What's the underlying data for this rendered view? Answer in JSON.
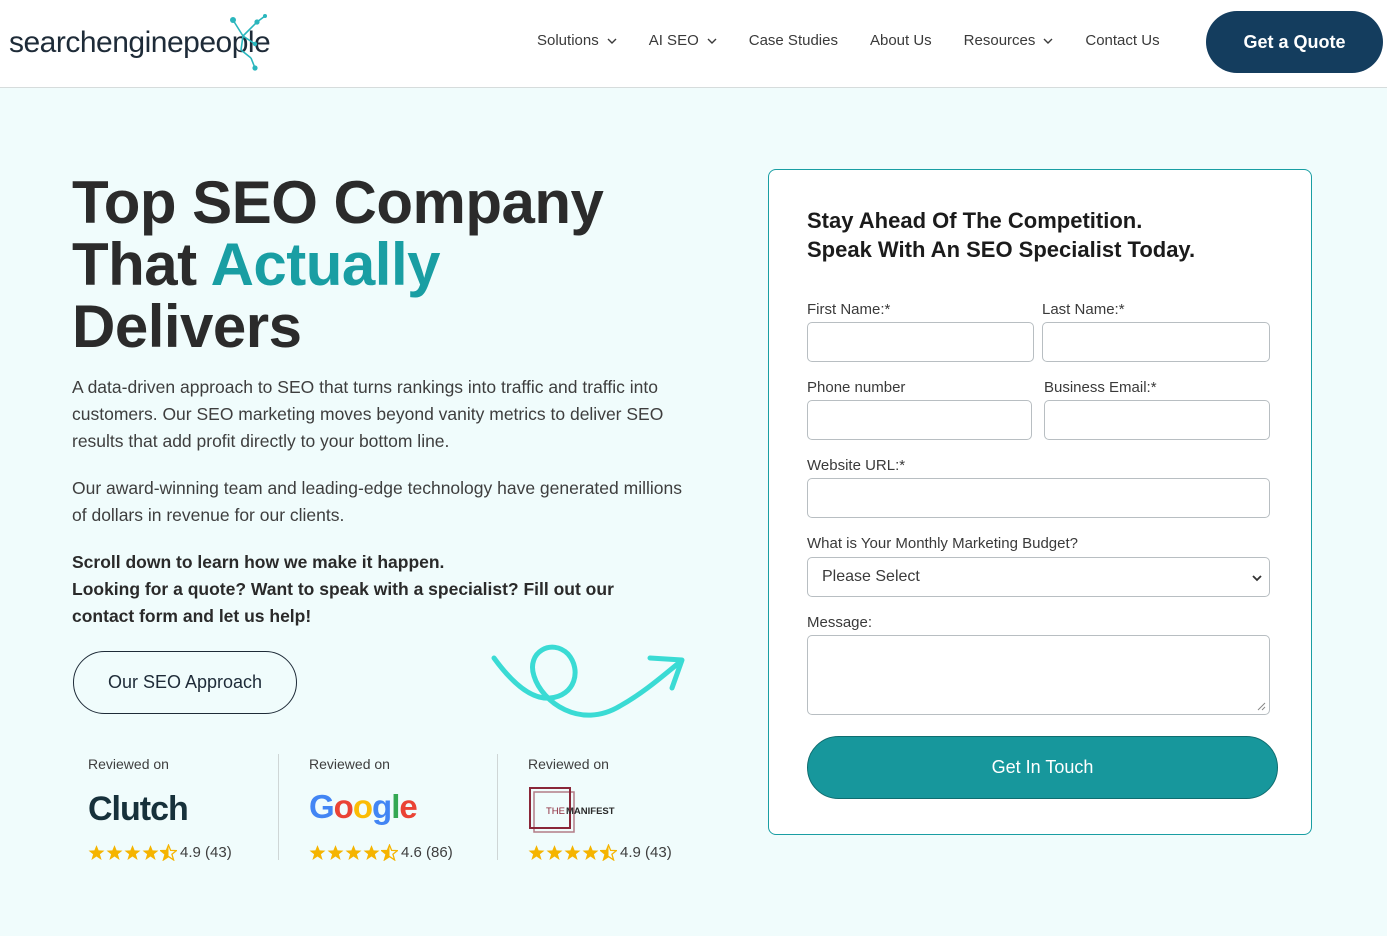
{
  "header": {
    "logo": {
      "text_start": "searchenginepe",
      "text_o": "o",
      "text_end": "ple",
      "icon": "network-nodes-icon"
    },
    "nav": [
      {
        "label": "Solutions",
        "has_dropdown": true
      },
      {
        "label": "AI SEO",
        "has_dropdown": true
      },
      {
        "label": "Case Studies",
        "has_dropdown": false
      },
      {
        "label": "About Us",
        "has_dropdown": false
      },
      {
        "label": "Resources",
        "has_dropdown": true
      },
      {
        "label": "Contact Us",
        "has_dropdown": false
      }
    ],
    "cta_label": "Get a Quote"
  },
  "hero": {
    "headline_line1": "Top SEO Company",
    "headline_line2_start": "That ",
    "headline_line2_accent": "Actually",
    "headline_line3": "Delivers",
    "para1": "A data-driven approach to SEO that turns rankings into traffic and traffic into customers. Our SEO marketing moves beyond vanity metrics to deliver SEO results that add profit directly to your bottom line.",
    "para2": "Our award-winning team and leading-edge technology have generated millions of dollars in revenue for our clients.",
    "para3_line1": "Scroll down to learn how we make it happen.",
    "para3_line2": "Looking for a quote? Want to speak with a specialist? Fill out our contact form and let us help!",
    "approach_button": "Our SEO Approach",
    "decoration": "squiggle-arrow-icon"
  },
  "reviews": [
    {
      "label": "Reviewed on",
      "platform": "Clutch",
      "rating_text": "4.9 (43)",
      "stars": 4.5
    },
    {
      "label": "Reviewed on",
      "platform": "Google",
      "rating_text": "4.6 (86)",
      "stars": 4.5
    },
    {
      "label": "Reviewed on",
      "platform_line1": "THE",
      "platform_line2": "MANIFEST",
      "rating_text": "4.9 (43)",
      "stars": 4.5
    }
  ],
  "form": {
    "title_line1": "Stay Ahead Of The Competition.",
    "title_line2": "Speak With An SEO Specialist Today.",
    "first_name_label": "First Name:*",
    "last_name_label": "Last Name:*",
    "phone_label": "Phone number",
    "email_label": "Business Email:*",
    "website_label": "Website URL:*",
    "budget_label": "What is Your Monthly Marketing Budget?",
    "budget_value": "Please Select",
    "message_label": "Message:",
    "submit_label": "Get In Touch"
  },
  "colors": {
    "accent": "#199ea3",
    "navy": "#143d5e",
    "background": "#f0fcfc",
    "star": "#f5b400"
  }
}
